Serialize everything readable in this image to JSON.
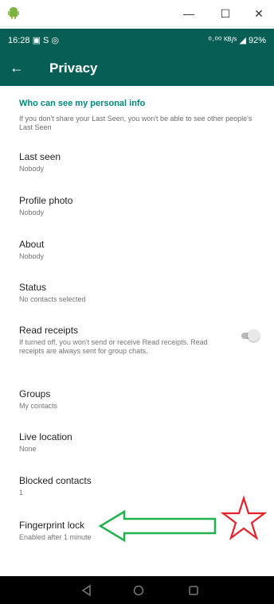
{
  "window": {
    "minimize_label": "—",
    "maximize_label": "☐",
    "close_label": "✕"
  },
  "status_bar": {
    "left": "16:28  ▣  S  ◎",
    "right": "⁰·⁰⁰ ᴷᴮ/ˢ  ◢  92%"
  },
  "appbar": {
    "back_label": "←",
    "title": "Privacy"
  },
  "section": {
    "title": "Who can see my personal info",
    "description": "If you don't share your Last Seen, you won't be able to see other people's Last Seen"
  },
  "settings": [
    {
      "title": "Last seen",
      "value": "Nobody"
    },
    {
      "title": "Profile photo",
      "value": "Nobody"
    },
    {
      "title": "About",
      "value": "Nobody"
    },
    {
      "title": "Status",
      "value": "No contacts selected"
    },
    {
      "title": "Read receipts",
      "value": "If turned off, you won't send or receive Read receipts. Read receipts are always sent for group chats.",
      "toggle": "off"
    },
    {
      "title": "Groups",
      "value": "My contacts"
    },
    {
      "title": "Live location",
      "value": "None"
    },
    {
      "title": "Blocked contacts",
      "value": "1"
    },
    {
      "title": "Fingerprint lock",
      "value": "Enabled after 1 minute"
    }
  ],
  "colors": {
    "primary": "#075e54",
    "accent": "#00897b",
    "annotation_arrow": "#22b14c",
    "annotation_star": "#e8202a"
  },
  "icons": {
    "app": "android-icon",
    "back": "arrow-back-icon",
    "nav": [
      "back-triangle-icon",
      "home-circle-icon",
      "recents-square-icon"
    ]
  }
}
